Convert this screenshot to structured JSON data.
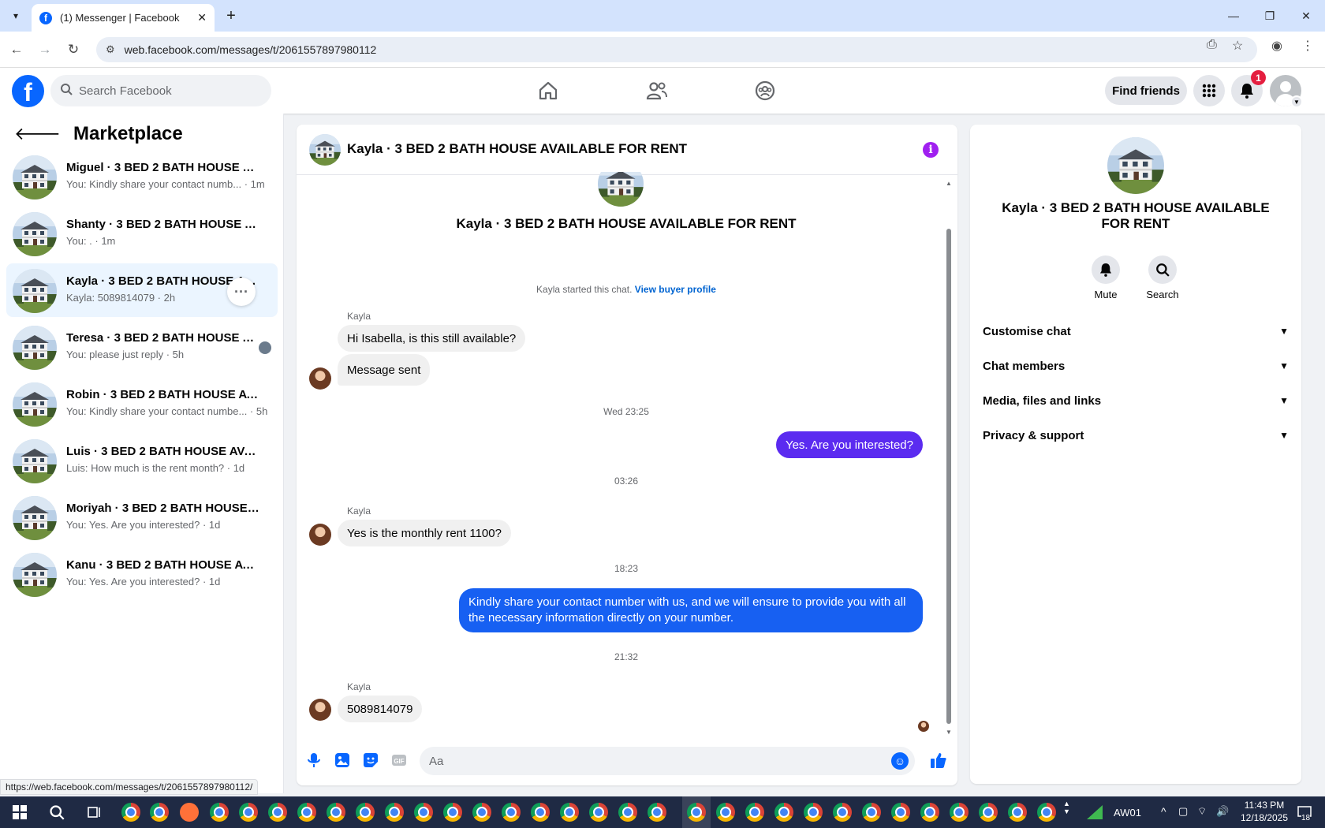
{
  "browser": {
    "tab_title": "(1) Messenger | Facebook",
    "url": "web.facebook.com/messages/t/2061557897980112",
    "status_url": "https://web.facebook.com/messages/t/2061557897980112/"
  },
  "fb": {
    "search_placeholder": "Search Facebook",
    "find_friends": "Find friends",
    "notification_count": "1"
  },
  "sidebar": {
    "title": "Marketplace",
    "conversations": [
      {
        "name": "Miguel · 3 BED 2 BATH HOUSE AV...",
        "preview": "You: Kindly share your contact numb... · 1m"
      },
      {
        "name": "Shanty · 3 BED 2 BATH HOUSE AV...",
        "preview": "You: . · 1m"
      },
      {
        "name": "Kayla · 3 BED 2 BATH HOUSE AV...",
        "preview": "Kayla: 5089814079 · 2h"
      },
      {
        "name": "Teresa · 3 BED 2 BATH HOUSE A...",
        "preview": "You: please just reply · 5h"
      },
      {
        "name": "Robin · 3 BED 2 BATH HOUSE AVAI...",
        "preview": "You: Kindly share your contact numbe... · 5h"
      },
      {
        "name": "Luis · 3 BED 2 BATH HOUSE AVAIL...",
        "preview": "Luis: How much is the rent month? · 1d"
      },
      {
        "name": "Moriyah · 3 BED 2 BATH HOUSE A...",
        "preview": "You: Yes. Are you interested? · 1d"
      },
      {
        "name": "Kanu · 3 BED 2 BATH HOUSE AVAI...",
        "preview": "You: Yes. Are you interested? · 1d"
      }
    ]
  },
  "chat": {
    "title": "Kayla · 3 BED 2 BATH HOUSE AVAILABLE FOR RENT",
    "started_text": "Kayla started this chat.",
    "buyer_profile_link": "View buyer profile",
    "sender_name": "Kayla",
    "messages": {
      "m1": "Hi Isabella, is this still available?",
      "m2": "Message sent",
      "t1": "Wed 23:25",
      "m3": "Yes. Are you interested?",
      "t2": "03:26",
      "m4": "Yes is the monthly rent 1100?",
      "t3": "18:23",
      "m5": "Kindly share your contact number with us, and we will ensure to provide you with all the necessary information directly on your number.",
      "t4": "21:32",
      "m6": "5089814079"
    },
    "composer_placeholder": "Aa"
  },
  "info_panel": {
    "title": "Kayla · 3 BED 2 BATH HOUSE AVAILABLE FOR RENT",
    "mute": "Mute",
    "search": "Search",
    "sections": [
      "Customise chat",
      "Chat members",
      "Media, files and links",
      "Privacy & support"
    ]
  },
  "taskbar": {
    "profile_label": "AW01",
    "time": "11:43 PM",
    "date": "12/18/2025",
    "notif_count": "18"
  },
  "colors": {
    "fb_blue": "#0866ff",
    "outgoing_purple": "#5b2bf0",
    "outgoing_blue": "#1760f2",
    "active_row": "#ebf5ff"
  }
}
